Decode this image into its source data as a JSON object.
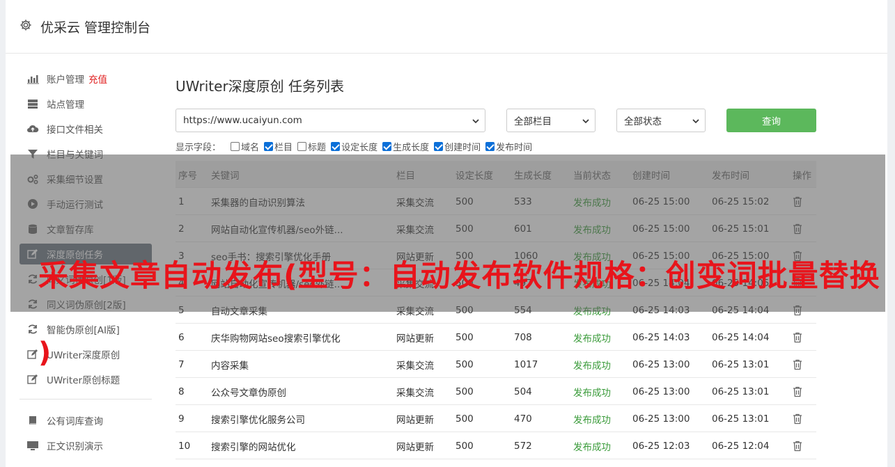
{
  "header": {
    "title": "优采云 管理控制台"
  },
  "sidebar": {
    "items": [
      {
        "icon": "bar-chart-icon",
        "label": "账户管理",
        "accent": "充值"
      },
      {
        "icon": "server-icon",
        "label": "站点管理"
      },
      {
        "icon": "cloud-upload-icon",
        "label": "接口文件相关"
      },
      {
        "icon": "filter-icon",
        "label": "栏目与关键词"
      },
      {
        "icon": "cogs-icon",
        "label": "采集细节设置"
      },
      {
        "icon": "play-circle-icon",
        "label": "手动运行测试"
      },
      {
        "icon": "database-icon",
        "label": "文章暂存库"
      },
      {
        "icon": "edit-icon",
        "label": "深度原创任务",
        "active": true
      },
      {
        "icon": "refresh-icon",
        "label": "同义词伪原创[1版]"
      },
      {
        "icon": "refresh-icon",
        "label": "同义词伪原创[2版]"
      },
      {
        "icon": "refresh-icon",
        "label": "智能伪原创[AI版]"
      },
      {
        "icon": "edit-icon",
        "label": "UWriter深度原创"
      },
      {
        "icon": "edit-icon",
        "label": "UWriter原创标题"
      }
    ],
    "items2": [
      {
        "icon": "book-icon",
        "label": "公有词库查询"
      },
      {
        "icon": "monitor-icon",
        "label": "正文识别演示"
      }
    ]
  },
  "main": {
    "title": "UWriter深度原创 任务列表",
    "site_select": "https://www.ucaiyun.com",
    "column_select": "全部栏目",
    "status_select": "全部状态",
    "query_label": "查询",
    "fields_label": "显示字段：",
    "fields": [
      {
        "label": "域名",
        "checked": false
      },
      {
        "label": "栏目",
        "checked": true
      },
      {
        "label": "标题",
        "checked": false
      },
      {
        "label": "设定长度",
        "checked": true
      },
      {
        "label": "生成长度",
        "checked": true
      },
      {
        "label": "创建时间",
        "checked": true
      },
      {
        "label": "发布时间",
        "checked": true
      }
    ],
    "table": {
      "headers": [
        "序号",
        "关键词",
        "栏目",
        "设定长度",
        "生成长度",
        "当前状态",
        "创建时间",
        "发布时间",
        "操作"
      ],
      "rows": [
        [
          "1",
          "采集器的自动识别算法",
          "采集交流",
          "500",
          "533",
          "发布成功",
          "06-25 15:00",
          "06-25 15:02"
        ],
        [
          "2",
          "网站自动化宣传机器/seo外链...",
          "采集交流",
          "500",
          "601",
          "发布成功",
          "06-25 15:00",
          "06-25 15:01"
        ],
        [
          "3",
          "seo手书：搜索引擎优化手册",
          "网站更新",
          "500",
          "1060",
          "发布成功",
          "06-25 15:00",
          "06-25 15:00"
        ],
        [
          "4",
          "网站自动化宣传机器/seo外链...",
          "采集交流",
          "500",
          "497",
          "发布成功",
          "06-25 14:04",
          "06-25 14:05"
        ],
        [
          "5",
          "自动文章采集",
          "采集交流",
          "500",
          "554",
          "发布成功",
          "06-25 14:03",
          "06-25 14:04"
        ],
        [
          "6",
          "庆华购物网站seo搜索引擎优化",
          "网站更新",
          "500",
          "708",
          "发布成功",
          "06-25 14:03",
          "06-25 14:04"
        ],
        [
          "7",
          "内容采集",
          "采集交流",
          "500",
          "1017",
          "发布成功",
          "06-25 13:00",
          "06-25 13:01"
        ],
        [
          "8",
          "公众号文章伪原创",
          "采集交流",
          "500",
          "504",
          "发布成功",
          "06-25 13:00",
          "06-25 13:01"
        ],
        [
          "9",
          "搜索引擎优化服务公司",
          "网站更新",
          "500",
          "470",
          "发布成功",
          "06-25 13:00",
          "06-25 13:01"
        ],
        [
          "10",
          "搜索引擎的网站优化",
          "网站更新",
          "500",
          "572",
          "发布成功",
          "06-25 12:03",
          "06-25 12:04"
        ]
      ]
    }
  },
  "overlay": {
    "text": "采集文章自动发布(型号：自动发布软件规格：创变词批量替换",
    "paren": ")"
  },
  "colors": {
    "accent": "#e02020",
    "success": "#3a9b3a",
    "button": "#5cb85c",
    "active_nav": "#6c7580"
  }
}
